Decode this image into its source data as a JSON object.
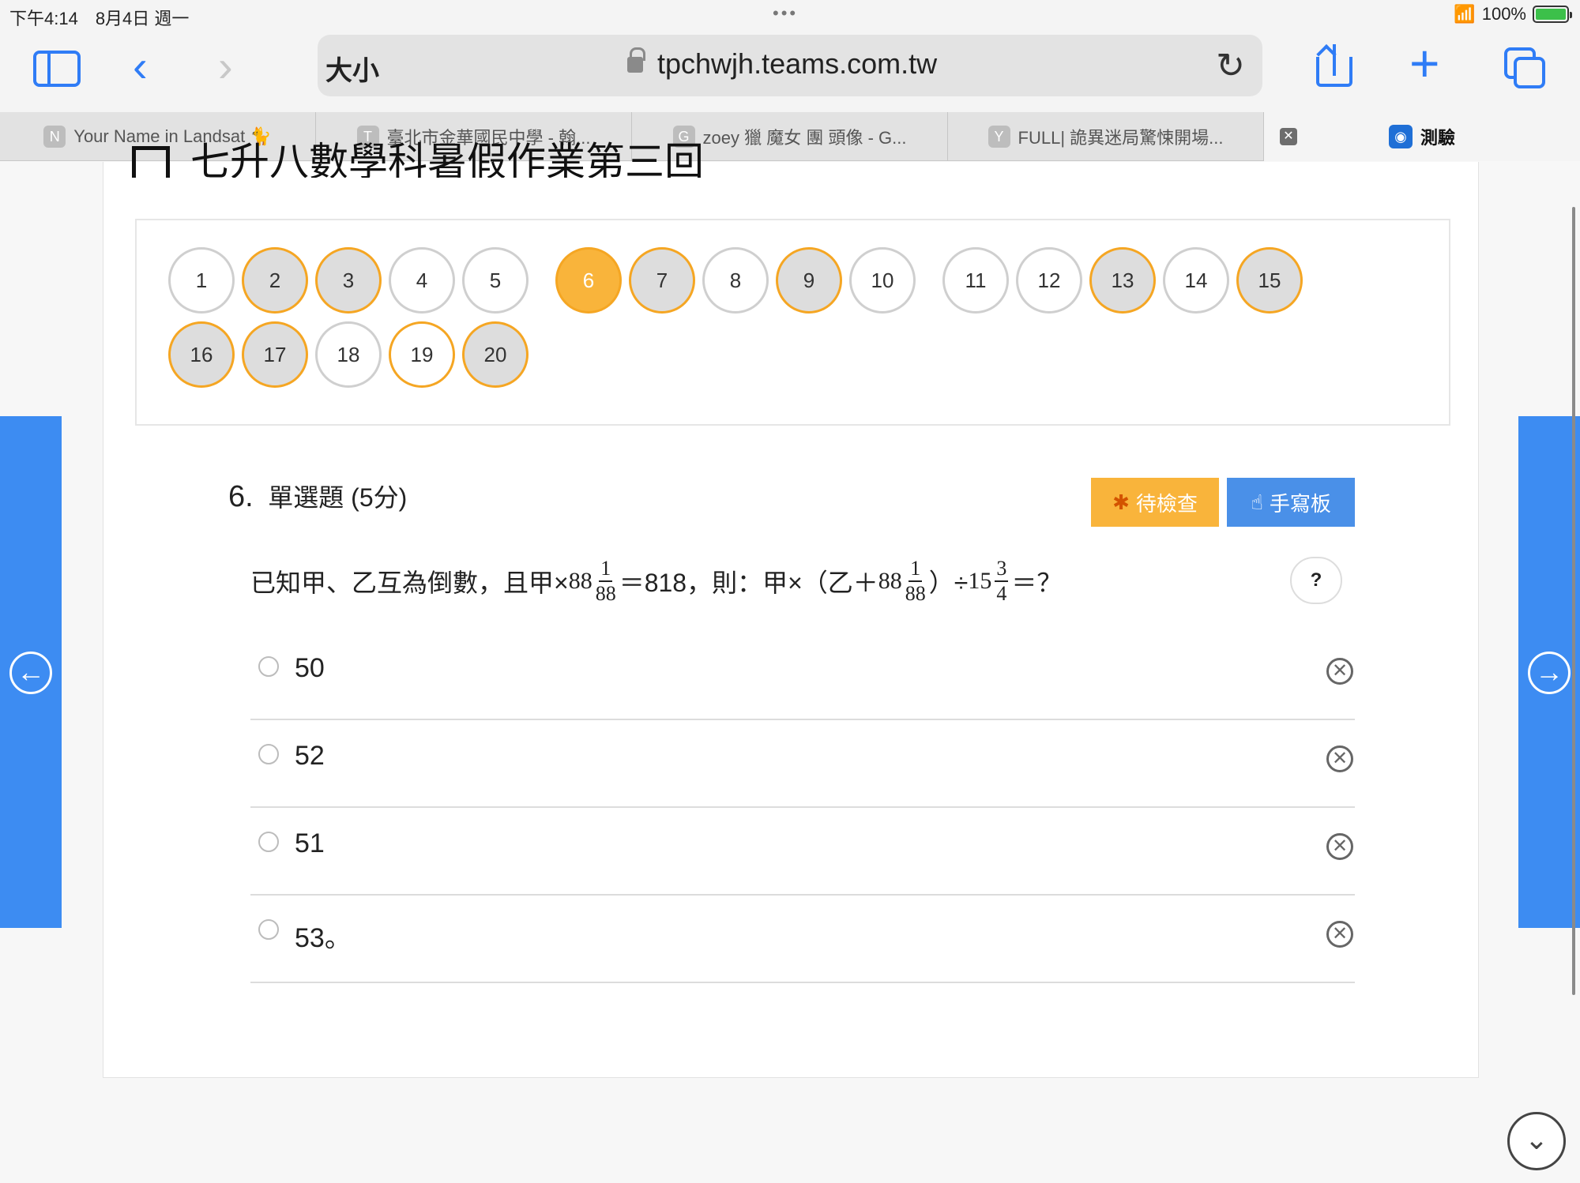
{
  "status_bar": {
    "time": "下午4:14　8月4日 週一",
    "dots": "•••",
    "battery": "100%"
  },
  "toolbar": {
    "size_label": "大小",
    "url": "tpchwjh.teams.com.tw"
  },
  "tabs": [
    {
      "favicon": "N",
      "title": "Your Name in Landsat 🐈"
    },
    {
      "favicon": "T",
      "title": "臺北市金華國民中學 - 翰..."
    },
    {
      "favicon": "G",
      "title": "zoey 獵 魔女 團 頭像 - G..."
    },
    {
      "favicon": "Y",
      "title": "FULL| 詭異迷局驚悚開場..."
    },
    {
      "favicon": "測",
      "title": "測驗",
      "active": true
    }
  ],
  "page": {
    "title_strip": "七升八數學科暑假作業第三回"
  },
  "question_nav": [
    {
      "n": "1",
      "state": "unanswered"
    },
    {
      "n": "2",
      "state": "answered"
    },
    {
      "n": "3",
      "state": "answered"
    },
    {
      "n": "4",
      "state": "unanswered"
    },
    {
      "n": "5",
      "state": "unanswered"
    },
    {
      "n": "6",
      "state": "current"
    },
    {
      "n": "7",
      "state": "answered"
    },
    {
      "n": "8",
      "state": "unanswered"
    },
    {
      "n": "9",
      "state": "answered"
    },
    {
      "n": "10",
      "state": "unanswered"
    },
    {
      "n": "11",
      "state": "unanswered"
    },
    {
      "n": "12",
      "state": "unanswered"
    },
    {
      "n": "13",
      "state": "answered"
    },
    {
      "n": "14",
      "state": "unanswered"
    },
    {
      "n": "15",
      "state": "answered"
    },
    {
      "n": "16",
      "state": "answered"
    },
    {
      "n": "17",
      "state": "answered"
    },
    {
      "n": "18",
      "state": "unanswered"
    },
    {
      "n": "19",
      "state": "marked"
    },
    {
      "n": "20",
      "state": "answered"
    }
  ],
  "question": {
    "number": "6.",
    "type": "單選題 (5分)",
    "pending_label": "待檢查",
    "handwrite_label": "手寫板",
    "help_label": "?",
    "text_part1": "已知甲、乙互為倒數，且甲×",
    "mixed1_whole": "88",
    "mixed1_num": "1",
    "mixed1_den": "88",
    "text_part2": "＝818，則：甲×（乙＋",
    "mixed2_whole": "88",
    "mixed2_num": "1",
    "mixed2_den": "88",
    "text_part3": "）÷",
    "mixed3_whole": "15",
    "mixed3_num": "3",
    "mixed3_den": "4",
    "text_part4": "＝？",
    "options": [
      "50",
      "52",
      "51",
      "53。"
    ]
  },
  "colors": {
    "accent_blue": "#3d8cf2",
    "accent_orange": "#f9b43b",
    "answered_border": "#f5a623"
  }
}
